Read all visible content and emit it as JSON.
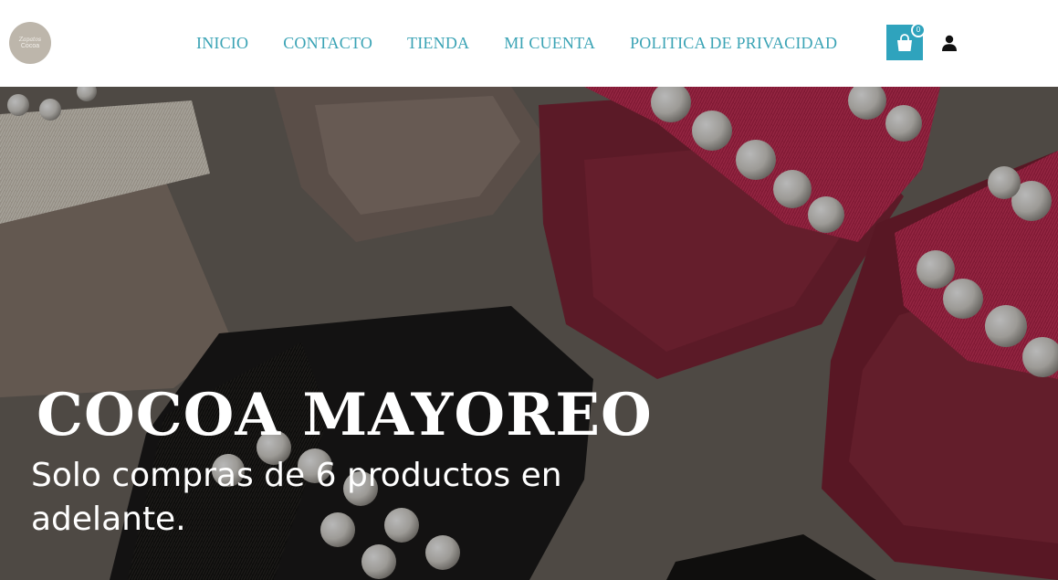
{
  "colors": {
    "accent": "#2fa3bd",
    "nav_text": "#3aa3b5",
    "logo_bg": "#bdb6ab",
    "hero_text": "#ffffff"
  },
  "header": {
    "logo": {
      "line1": "Zapatos",
      "line2": "Cocoa"
    },
    "nav": [
      {
        "label": "INICIO"
      },
      {
        "label": "CONTACTO"
      },
      {
        "label": "TIENDA"
      },
      {
        "label": "MI CUENTA"
      },
      {
        "label": "POLITICA DE PRIVACIDAD"
      }
    ],
    "cart": {
      "icon": "shopping-bag-icon",
      "count": "0"
    },
    "account": {
      "icon": "user-icon"
    }
  },
  "hero": {
    "image": "sandals-with-pearls-image",
    "title": "COCOA MAYOREO",
    "subtitle": "Solo compras de 6 productos en adelante."
  }
}
